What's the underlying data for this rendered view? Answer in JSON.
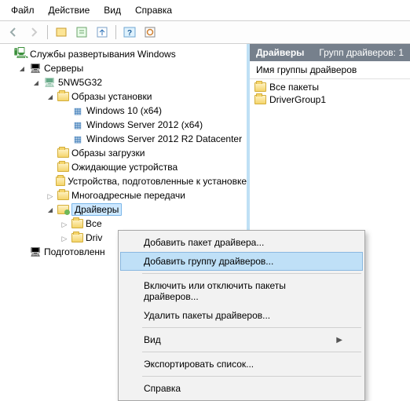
{
  "menubar": {
    "file": "Файл",
    "action": "Действие",
    "view": "Вид",
    "help": "Справка"
  },
  "tree": {
    "root": "Службы развертывания Windows",
    "servers": "Серверы",
    "server_name": "5NW5G32",
    "install_images": "Образы установки",
    "img_win10": "Windows 10 (x64)",
    "img_ws2012": "Windows Server 2012 (x64)",
    "img_ws2012r2": "Windows Server 2012 R2 Datacenter",
    "boot_images": "Образы загрузки",
    "pending_devices": "Ожидающие устройства",
    "prestaged": "Устройства, подготовленные к установке",
    "multicast": "Многоадресные передачи",
    "drivers": "Драйверы",
    "all_drv": "Все",
    "drv_group1": "Driv",
    "prepared": "Подготовленн"
  },
  "list": {
    "header_left": "Драйверы",
    "header_right": "Групп драйверов: 1",
    "col_name": "Имя группы драйверов",
    "items": [
      "Все пакеты",
      "DriverGroup1"
    ]
  },
  "context": {
    "add_pkg": "Добавить пакет драйвера...",
    "add_group": "Добавить группу драйверов...",
    "enable_disable": "Включить или отключить пакеты драйверов...",
    "delete": "Удалить пакеты драйверов...",
    "view": "Вид",
    "export": "Экспортировать список...",
    "help": "Справка"
  }
}
